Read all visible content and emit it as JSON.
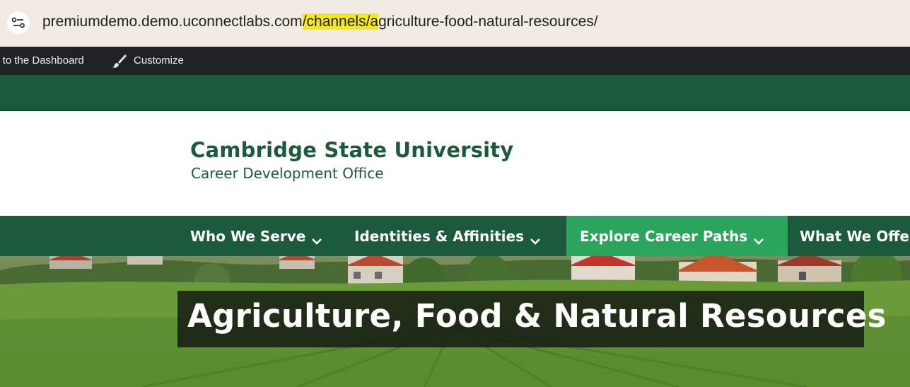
{
  "browser": {
    "url_prefix": "premiumdemo.demo.uconnectlabs.com",
    "url_highlight": "/channels/a",
    "url_suffix": "griculture-food-natural-resources/",
    "site_info_icon": "site-settings-icon",
    "highlight_color": "#f4e81a"
  },
  "admin_bar": {
    "dashboard_label": "k to the Dashboard",
    "customize_label": "Customize",
    "customize_icon": "paintbrush-icon"
  },
  "brand": {
    "title": "Cambridge State University",
    "subtitle": "Career Development Office",
    "color": "#1c5a3c"
  },
  "nav": {
    "items": [
      {
        "label": "Who We Serve",
        "icon": "chevron-down-icon"
      },
      {
        "label": "Identities & Affinities",
        "icon": "chevron-down-icon"
      },
      {
        "label": "Explore Career Paths",
        "icon": "chevron-down-icon",
        "active": true
      },
      {
        "label": "What We Offe"
      }
    ],
    "active_color": "#2aa55b"
  },
  "hero": {
    "title": "Agriculture, Food & Natural Resources"
  }
}
